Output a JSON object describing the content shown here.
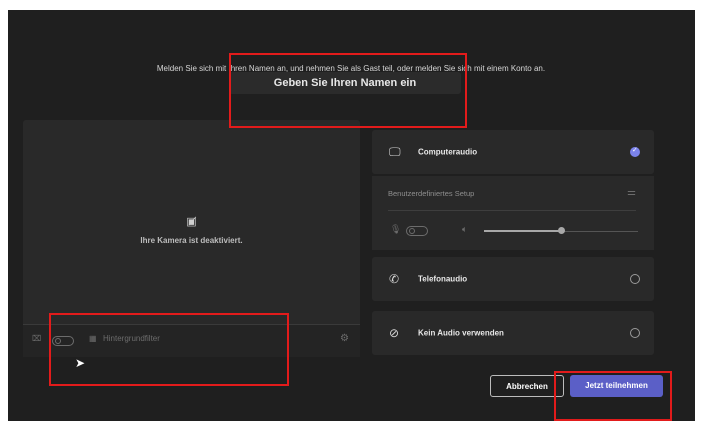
{
  "intro_text": "Melden Sie sich mit Ihren Namen an, und nehmen Sie als Gast teil, oder melden Sie sich mit einem Konto an.",
  "name_input_text": "Geben Sie Ihren Namen ein",
  "video": {
    "camera_off_text": "Ihre Kamera ist deaktiviert.",
    "background_filter_label": "Hintergrundfilter"
  },
  "audio": {
    "computer_audio": "Computeraudio",
    "custom_setup": "Benutzerdefiniertes Setup",
    "phone_audio": "Telefonaudio",
    "no_audio": "Kein Audio verwenden",
    "speaker_volume_fraction": 0.5
  },
  "buttons": {
    "cancel": "Abbrechen",
    "join": "Jetzt teilnehmen"
  },
  "colors": {
    "background": "#1f1f1f",
    "panel": "#292929",
    "accent": "#5b5fc7",
    "highlight": "#e21b1b"
  },
  "icons": {
    "camera_off": "camera-off-icon",
    "computer_audio": "monitor-speaker-icon",
    "phone": "phone-icon",
    "no_audio": "speaker-off-icon",
    "settings": "gear-icon",
    "mic": "mic-off-icon",
    "speaker": "speaker-icon",
    "sliders": "sliders-icon"
  }
}
